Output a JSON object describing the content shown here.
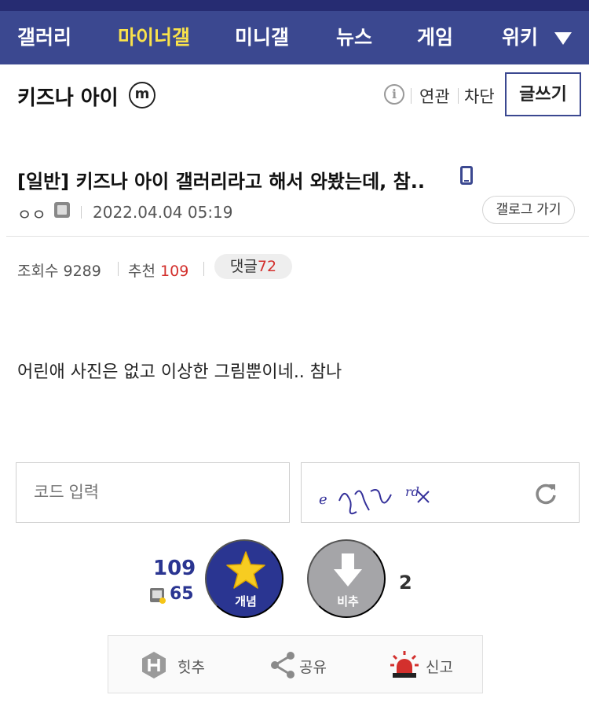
{
  "nav": {
    "items": [
      "갤러리",
      "마이너갤",
      "미니갤",
      "뉴스",
      "게임",
      "위키"
    ],
    "active_index": 1
  },
  "gallery": {
    "title": "키즈나 아이",
    "minor_badge": "m",
    "info_icon": "i",
    "related_label": "연관",
    "block_label": "차단",
    "write_button": "글쓰기"
  },
  "post": {
    "title": "[일반] 키즈나 아이 갤러리라고 해서 와봤는데, 참..",
    "writer": "ㅇㅇ",
    "date": "2022.04.04 05:19",
    "gallog_button": "갤로그 가기",
    "views_label": "조회수",
    "views": "9289",
    "recommend_label": "추천",
    "recommend": "109",
    "comment_label": "댓글",
    "comments": "72",
    "body": "어린애 사진은 없고 이상한 그림뿐이네.. 참나"
  },
  "captcha": {
    "placeholder": "코드 입력",
    "image_text": "e ë́ жx"
  },
  "vote": {
    "up_count": "109",
    "fixed_count": "65",
    "up_label": "개념",
    "down_label": "비추",
    "down_count": "2"
  },
  "actions": {
    "hit_label": "힛추",
    "share_label": "공유",
    "report_label": "신고"
  },
  "colors": {
    "nav_bg": "#3b4890",
    "nav_active": "#f9e24b",
    "accent": "#2a3591",
    "highlight_red": "#d3302d"
  }
}
